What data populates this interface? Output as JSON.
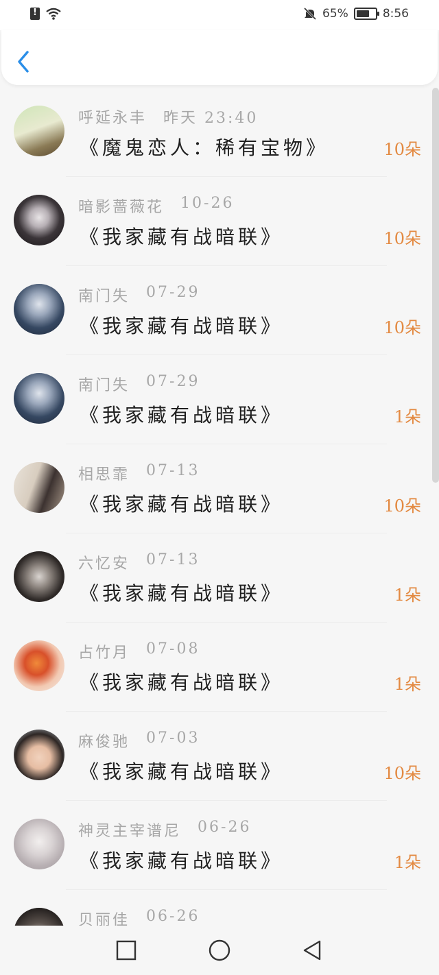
{
  "status_bar": {
    "battery_percent_text": "65%",
    "time": "8:56",
    "icons": [
      "alert-icon",
      "wifi-icon",
      "mute-icon",
      "battery-icon"
    ]
  },
  "header": {
    "back_icon": "chevron-left-icon",
    "accent": "#2a8ee8"
  },
  "colors": {
    "count": "#e38a42",
    "meta": "#a7a7a7"
  },
  "items": [
    {
      "name": "呼延永丰",
      "date": "昨天 23:40",
      "gift": "《魔鬼恋人：稀有宝物》",
      "count": "10朵"
    },
    {
      "name": "暗影蔷薇花",
      "date": "10-26",
      "gift": "《我家藏有战暗联》",
      "count": "10朵"
    },
    {
      "name": "南门失",
      "date": "07-29",
      "gift": "《我家藏有战暗联》",
      "count": "10朵"
    },
    {
      "name": "南门失",
      "date": "07-29",
      "gift": "《我家藏有战暗联》",
      "count": "1朵"
    },
    {
      "name": "相思霏",
      "date": "07-13",
      "gift": "《我家藏有战暗联》",
      "count": "10朵"
    },
    {
      "name": "六忆安",
      "date": "07-13",
      "gift": "《我家藏有战暗联》",
      "count": "1朵"
    },
    {
      "name": "占竹月",
      "date": "07-08",
      "gift": "《我家藏有战暗联》",
      "count": "1朵"
    },
    {
      "name": "麻俊驰",
      "date": "07-03",
      "gift": "《我家藏有战暗联》",
      "count": "10朵"
    },
    {
      "name": "神灵主宰谱尼",
      "date": "06-26",
      "gift": "《我家藏有战暗联》",
      "count": "1朵"
    },
    {
      "name": "贝丽佳",
      "date": "06-26",
      "gift": "",
      "count": ""
    }
  ],
  "nav": {
    "icons": [
      "square-recent-icon",
      "circle-home-icon",
      "triangle-back-icon"
    ]
  }
}
